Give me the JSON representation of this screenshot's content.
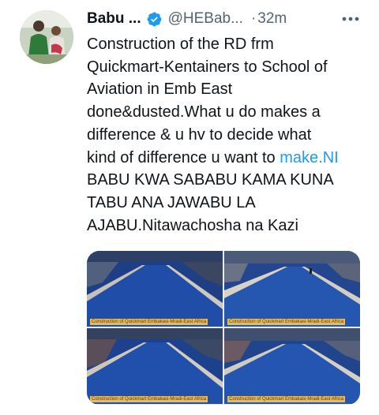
{
  "tweet": {
    "author_name": "Babu ...",
    "handle": "@HEBab...",
    "separator": "·",
    "time": "32m",
    "more_icon": "more-horizontal-icon",
    "verified_icon": "verified-badge-icon",
    "text_lines": [
      "Construction of the RD frm",
      "Quickmart-Kentainers to School of",
      "Aviation in Emb East",
      "done&dusted.What u do makes a",
      "difference & u hv to decide what"
    ],
    "text_line6_prefix": "kind of difference u want to ",
    "link_text": "make.NI",
    "text_lines_after": [
      "BABU KWA SABABU KAMA KUNA",
      "TABU ANA JAWABU LA",
      "AJABU.Nitawachosha na Kazi"
    ],
    "photos": [
      {
        "caption": "Construction of Quickmart Embakasi-Mradi-East Africa"
      },
      {
        "caption": "Construction of Quickmart Embakasi-Mradi-East Africa"
      },
      {
        "caption": "Construction of Quickmart Embakasi-Mradi-East Africa"
      },
      {
        "caption": "Construction of Quickmart Embakasi-Mradi-East Africa"
      }
    ]
  },
  "colors": {
    "text": "#0f1419",
    "secondary": "#536471",
    "link": "#1d9bf0",
    "verified": "#1d9bf0"
  }
}
